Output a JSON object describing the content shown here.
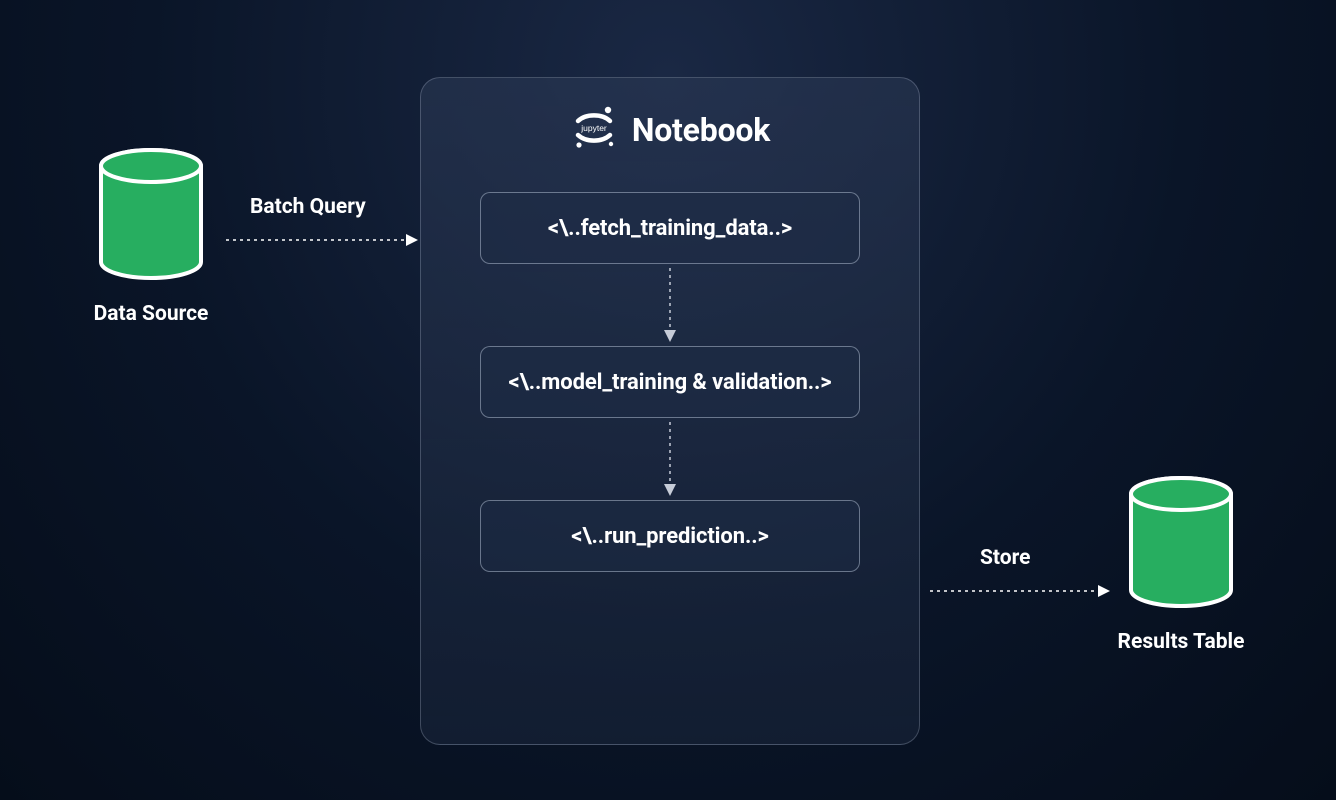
{
  "notebook": {
    "title": "Notebook",
    "icon_name": "jupyter-icon",
    "steps": [
      "<\\..fetch_training_data..>",
      "<\\..model_training & validation..>",
      "<\\..run_prediction..>"
    ]
  },
  "data_source": {
    "label": "Data Source",
    "connector_label": "Batch Query"
  },
  "results": {
    "label": "Results Table",
    "connector_label": "Store"
  },
  "colors": {
    "db_green": "#27AE60",
    "db_outline": "#FFFFFF",
    "bg_dark": "#0a1528",
    "box_border": "rgba(205,215,235,0.45)"
  }
}
